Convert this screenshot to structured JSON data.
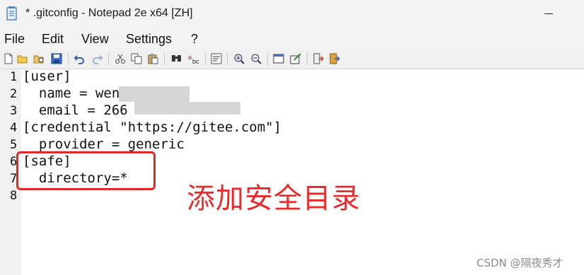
{
  "window": {
    "title": "* .gitconfig - Notepad 2e x64 [ZH]"
  },
  "menu": {
    "items": [
      "File",
      "Edit",
      "View",
      "Settings",
      "?"
    ]
  },
  "toolbar": {
    "buttons": [
      "new-file-icon",
      "open-file-icon",
      "browse-icon",
      "save-icon",
      "undo-icon",
      "redo-icon",
      "cut-icon",
      "copy-icon",
      "paste-icon",
      "find-icon",
      "replace-icon",
      "word-wrap-icon",
      "zoom-in-icon",
      "zoom-out-icon",
      "scheme-icon",
      "customize-schemes-icon",
      "exit-icon"
    ]
  },
  "editor": {
    "line_numbers": [
      "1",
      "2",
      "3",
      "4",
      "5",
      "6",
      "7",
      "8"
    ],
    "lines": [
      "[user]",
      "  name = wen",
      "  email = 266",
      "[credential \"https://gitee.com\"]",
      "  provider = generic",
      "[safe]",
      "  directory=*",
      ""
    ]
  },
  "annotation": {
    "text": "添加安全目录",
    "color": "#e82b2b"
  },
  "watermark": {
    "text": "CSDN @隔夜秀才"
  },
  "colors": {
    "highlight_border": "#e32626",
    "gutter_bg": "#f1f1f1",
    "titlebar_bg": "#f3f3f3"
  }
}
